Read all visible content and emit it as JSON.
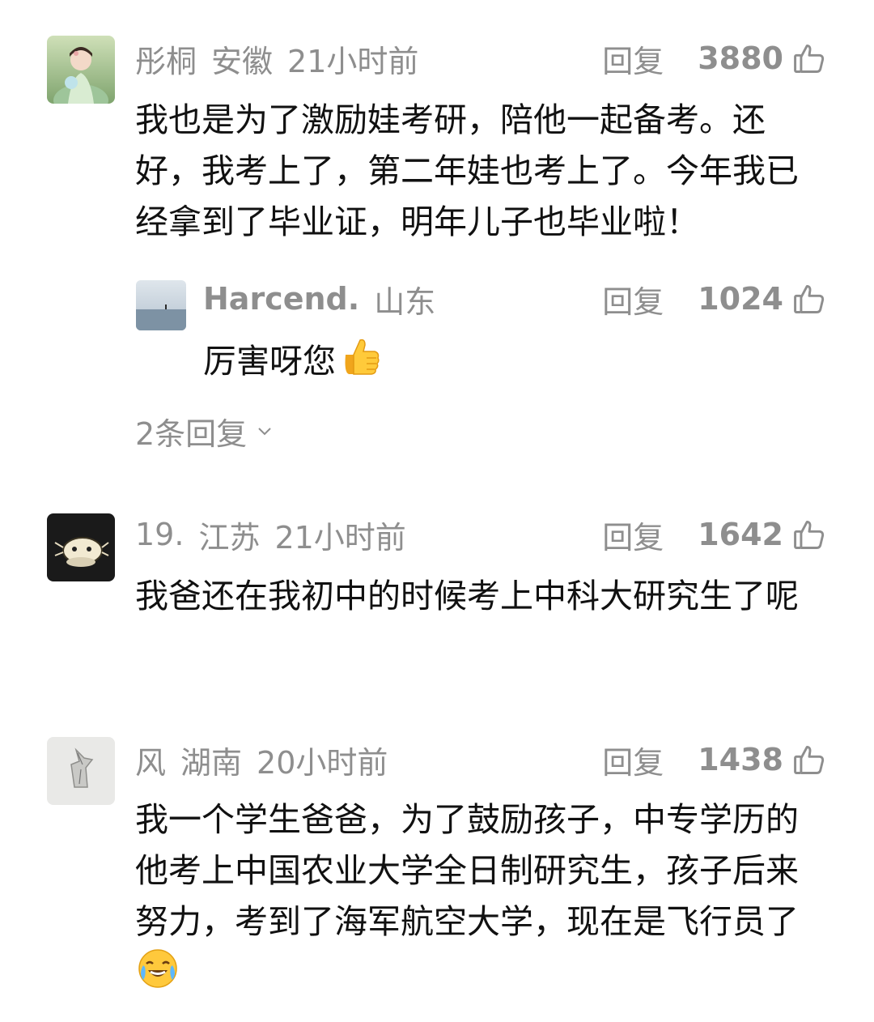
{
  "comments": [
    {
      "name": "彤桐",
      "region": "安徽",
      "time": "21小时前",
      "reply_label": "回复",
      "likes": "3880",
      "text": "我也是为了激励娃考研，陪他一起备考。还好，我考上了，第二年娃也考上了。今年我已经拿到了毕业证，明年儿子也毕业啦！",
      "sub_reply": {
        "name": "Harcend.",
        "region": "山东",
        "reply_label": "回复",
        "likes": "1024",
        "text": "厉害呀您",
        "emoji": "thumbs-up-emoji"
      },
      "more_replies": "2条回复"
    },
    {
      "name": "19.",
      "region": "江苏",
      "time": "21小时前",
      "reply_label": "回复",
      "likes": "1642",
      "text": "我爸还在我初中的时候考上中科大研究生了呢"
    },
    {
      "name": "风",
      "region": "湖南",
      "time": "20小时前",
      "reply_label": "回复",
      "likes": "1438",
      "text": "我一个学生爸爸，为了鼓励孩子，中专学历的他考上中国农业大学全日制研究生，孩子后来努力，考到了海军航空大学，现在是飞行员了",
      "emoji": "crying-laughing-emoji"
    }
  ],
  "colors": {
    "meta_gray": "#8e8e8e",
    "body_text": "#111111",
    "background": "#ffffff"
  }
}
